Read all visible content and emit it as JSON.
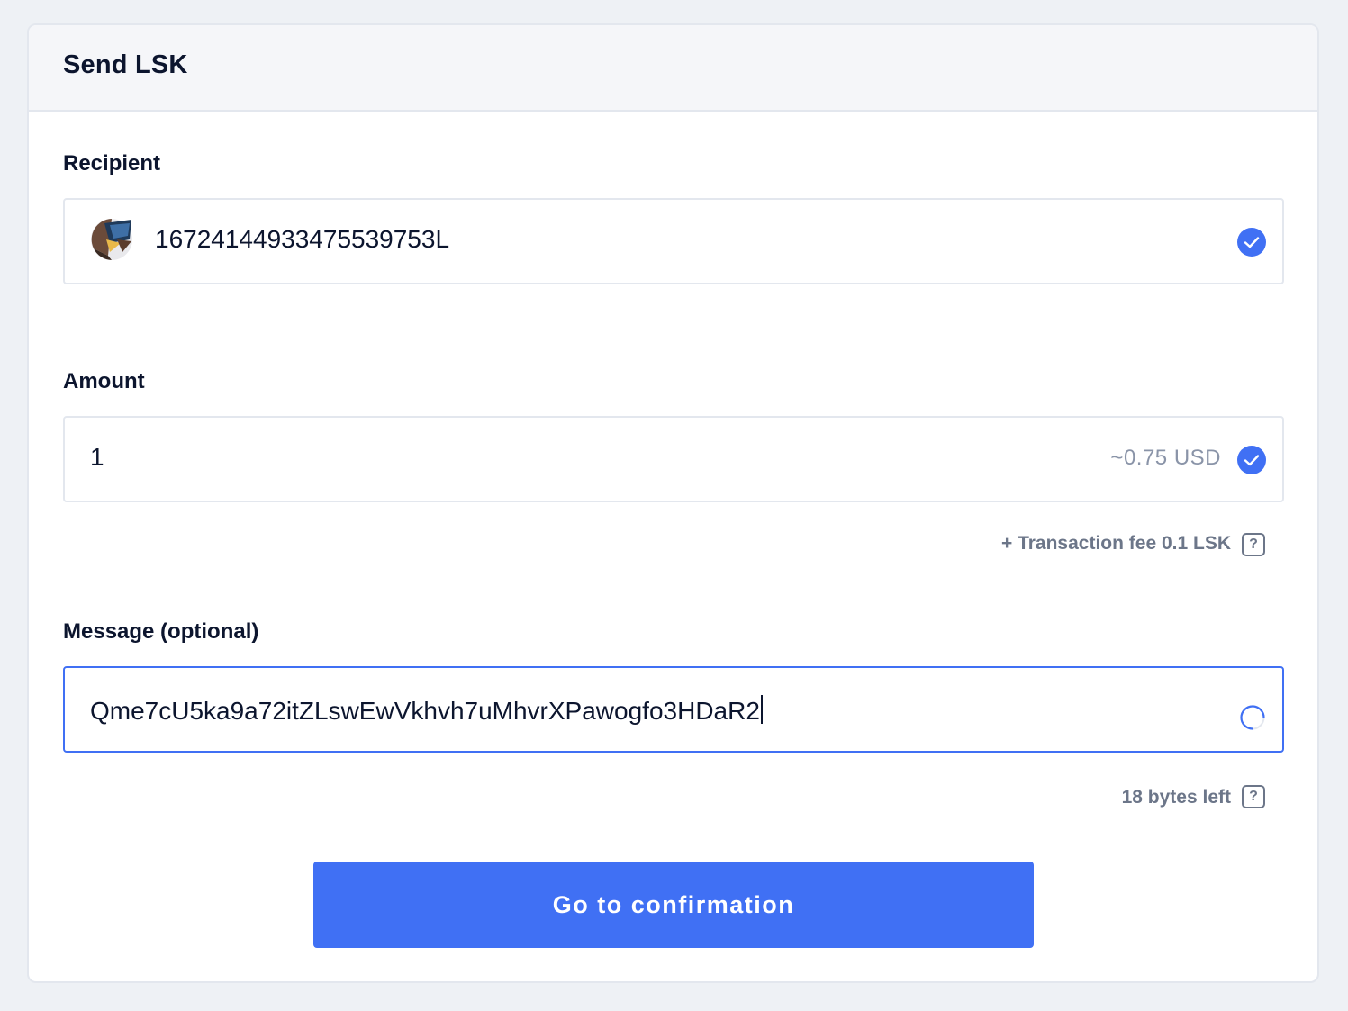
{
  "header": {
    "title": "Send LSK"
  },
  "recipient": {
    "label": "Recipient",
    "address": "16724144933475539753L",
    "avatar_icon": "account-avatar",
    "status_icon": "check-icon"
  },
  "amount": {
    "label": "Amount",
    "value": "1",
    "usd_equivalent": "~0.75 USD",
    "status_icon": "check-icon",
    "fee_text": "+ Transaction fee 0.1 LSK",
    "help_label": "?"
  },
  "message": {
    "label": "Message (optional)",
    "value": "Qme7cU5ka9a72itZLswEwVkhvh7uMhvrXPawogfo3HDaR2",
    "status_icon": "loading-spinner-icon",
    "bytes_left": "18 bytes left",
    "help_label": "?"
  },
  "actions": {
    "submit_label": "Go to confirmation"
  },
  "colors": {
    "accent": "#4070f4",
    "text": "#0c152e",
    "muted": "#8a94a8",
    "border": "#e3e7ee",
    "header_bg": "#f5f6f9",
    "page_bg": "#eef1f5"
  }
}
